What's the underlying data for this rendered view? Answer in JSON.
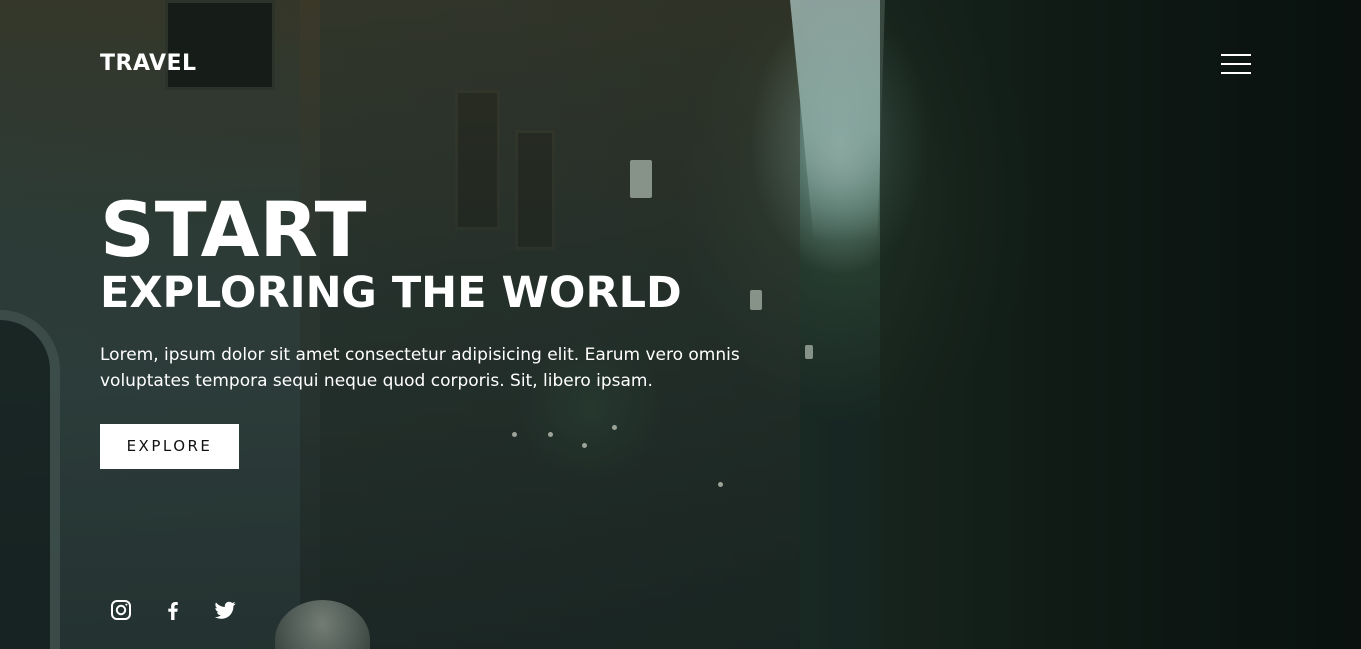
{
  "header": {
    "logo": "TRAVEL",
    "menu_icon": "hamburger-menu-icon"
  },
  "hero": {
    "title_line1": "START",
    "title_line2": "EXPLORING THE WORLD",
    "description": "Lorem, ipsum dolor sit amet consectetur adipisicing elit. Earum vero omnis voluptates tempora sequi neque quod corporis. Sit, libero ipsam.",
    "cta_label": "EXPLORE"
  },
  "social": {
    "icons": [
      "instagram-icon",
      "facebook-icon",
      "twitter-icon"
    ]
  },
  "colors": {
    "text": "#ffffff",
    "button_bg": "#ffffff",
    "button_text": "#111111",
    "overlay": "#0a1916"
  }
}
